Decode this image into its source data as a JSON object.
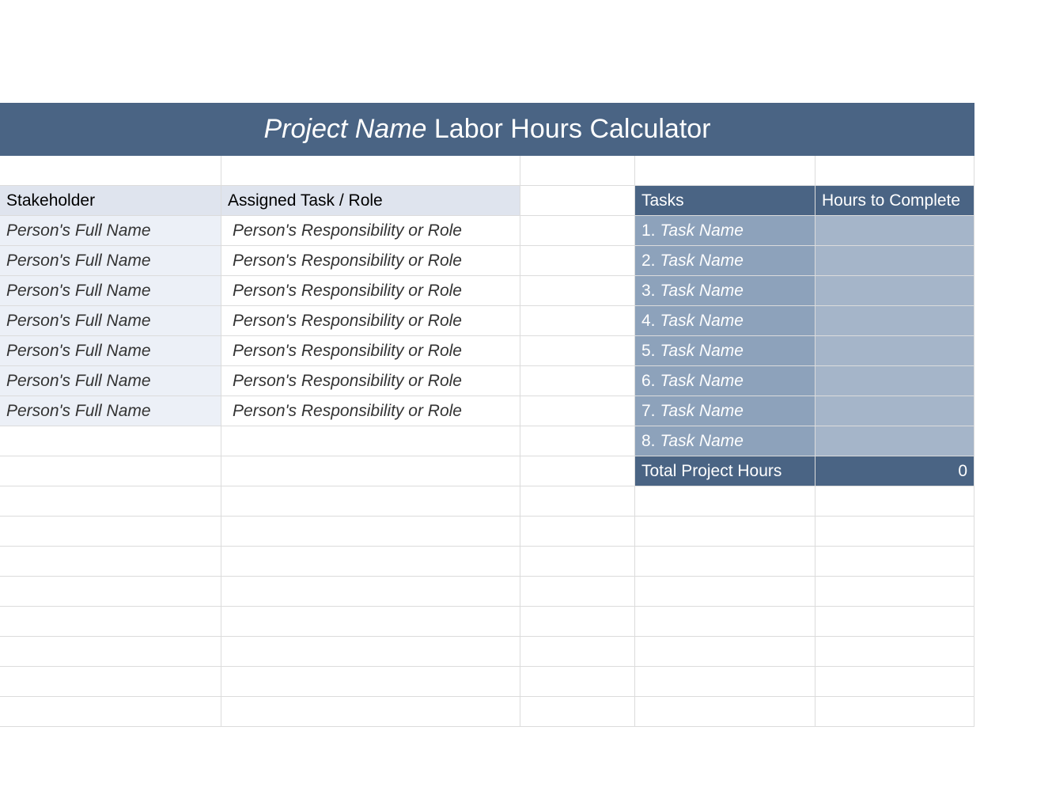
{
  "title": {
    "prefix_italic": "Project Name",
    "rest": " Labor Hours Calculator"
  },
  "headers": {
    "stakeholder": "Stakeholder",
    "assigned_task": "Assigned Task / Role",
    "tasks": "Tasks",
    "hours_to_complete": "Hours to Complete"
  },
  "stakeholders": [
    {
      "name": "Person's Full Name",
      "role": "Person's Responsibility or Role"
    },
    {
      "name": "Person's Full Name",
      "role": "Person's Responsibility or Role"
    },
    {
      "name": "Person's Full Name",
      "role": "Person's Responsibility or Role"
    },
    {
      "name": "Person's Full Name",
      "role": "Person's Responsibility or Role"
    },
    {
      "name": "Person's Full Name",
      "role": "Person's Responsibility or Role"
    },
    {
      "name": "Person's Full Name",
      "role": "Person's Responsibility or Role"
    },
    {
      "name": "Person's Full Name",
      "role": "Person's Responsibility or Role"
    }
  ],
  "tasks": [
    {
      "num": "1.",
      "name": "Task Name",
      "hours": ""
    },
    {
      "num": "2.",
      "name": "Task Name",
      "hours": ""
    },
    {
      "num": "3.",
      "name": "Task Name",
      "hours": ""
    },
    {
      "num": "4.",
      "name": "Task Name",
      "hours": ""
    },
    {
      "num": "5.",
      "name": "Task Name",
      "hours": ""
    },
    {
      "num": "6.",
      "name": "Task Name",
      "hours": ""
    },
    {
      "num": "7.",
      "name": "Task Name",
      "hours": ""
    },
    {
      "num": "8.",
      "name": "Task Name",
      "hours": ""
    }
  ],
  "total": {
    "label": "Total Project Hours",
    "value": "0"
  }
}
